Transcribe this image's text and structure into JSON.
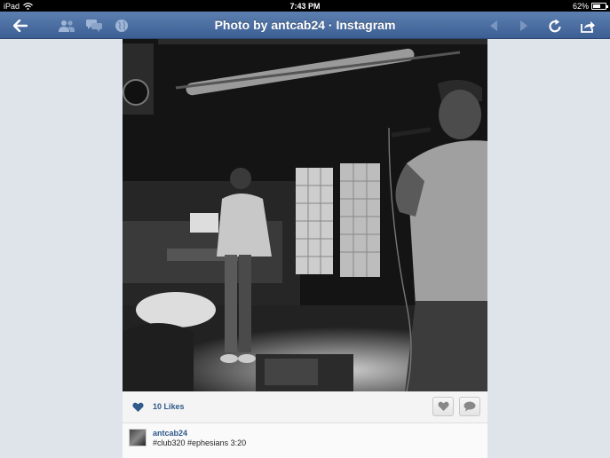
{
  "status_bar": {
    "device": "iPad",
    "time": "7:43 PM",
    "battery": "62%",
    "battery_level": 0.62
  },
  "nav_bar": {
    "title": "Photo by antcab24 · Instagram",
    "icons": [
      "back-arrow-icon",
      "people-icon",
      "speech-bubbles-icon",
      "globe-icon",
      "nav-back-icon",
      "nav-forward-icon",
      "refresh-icon",
      "share-icon"
    ]
  },
  "post": {
    "likes": "10 Likes",
    "username": "antcab24",
    "caption": "#club320 #ephesians 3:20"
  },
  "colors": {
    "nav_bar": "#4a6fa5",
    "link_text": "#2f5a8a",
    "background": "#dfe4ea"
  }
}
